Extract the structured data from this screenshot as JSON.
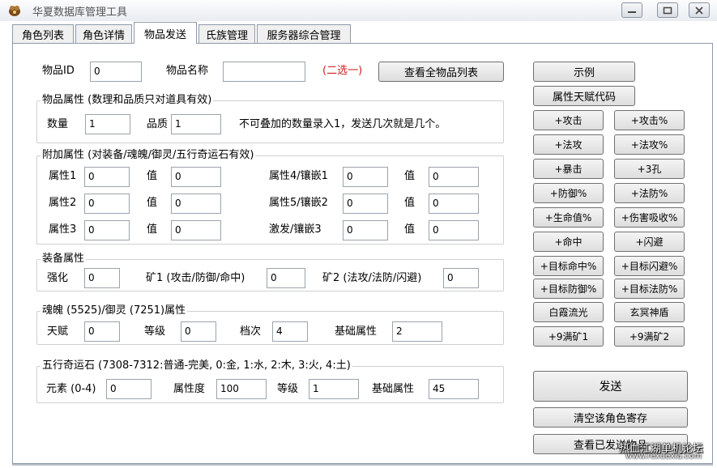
{
  "window": {
    "title": "华夏数据库管理工具",
    "min_icon": "minimize-icon",
    "max_icon": "maximize-icon",
    "close_icon": "close-icon"
  },
  "tabs": [
    {
      "label": "角色列表"
    },
    {
      "label": "角色详情"
    },
    {
      "label": "物品发送",
      "active": true
    },
    {
      "label": "氏族管理"
    },
    {
      "label": "服务器综合管理"
    }
  ],
  "item": {
    "id_label": "物品ID",
    "id_value": "0",
    "name_label": "物品名称",
    "name_value": "",
    "choose_hint": "(二选一)",
    "view_all_button": "查看全物品列表"
  },
  "attr_group": {
    "legend": "物品属性 (数理和品质只对道具有效)",
    "qty_label": "数量",
    "qty_value": "1",
    "quality_label": "品质",
    "quality_value": "1",
    "note": "不可叠加的数量录入1，发送几次就是几个。"
  },
  "extra_group": {
    "legend": "附加属性 (对装备/魂魄/御灵/五行奇运石有效)",
    "value_label": "值",
    "rows": [
      {
        "a_label": "属性1",
        "a_val": "0",
        "a_v": "0",
        "b_label": "属性4/镶嵌1",
        "b_val": "0",
        "b_v": "0"
      },
      {
        "a_label": "属性2",
        "a_val": "0",
        "a_v": "0",
        "b_label": "属性5/镶嵌2",
        "b_val": "0",
        "b_v": "0"
      },
      {
        "a_label": "属性3",
        "a_val": "0",
        "a_v": "0",
        "b_label": "激发/镶嵌3",
        "b_val": "0",
        "b_v": "0"
      }
    ]
  },
  "equip_group": {
    "legend": "装备属性",
    "enhance_label": "强化",
    "enhance_value": "0",
    "mine1_label": "矿1 (攻击/防御/命中)",
    "mine1_value": "0",
    "mine2_label": "矿2 (法攻/法防/闪避)",
    "mine2_value": "0"
  },
  "soul_group": {
    "legend": "魂魄 (5525)/御灵 (7251)属性",
    "talent_label": "天赋",
    "talent_value": "0",
    "level_label": "等级",
    "level_value": "0",
    "grade_label": "档次",
    "grade_value": "4",
    "base_label": "基础属性",
    "base_value": "2"
  },
  "stone_group": {
    "legend": "五行奇运石 (7308-7312:普通-完美, 0:金, 1:水, 2:木, 3:火, 4:土)",
    "element_label": "元素 (0-4)",
    "element_value": "0",
    "degree_label": "属性度",
    "degree_value": "100",
    "level_label": "等级",
    "level_value": "1",
    "base_label": "基础属性",
    "base_value": "45"
  },
  "right": {
    "example": "示例",
    "talent_code": "属性天赋代码",
    "pairs": [
      [
        "+攻击",
        "+攻击%"
      ],
      [
        "+法攻",
        "+法攻%"
      ],
      [
        "+暴击",
        "+3孔"
      ],
      [
        "+防御%",
        "+法防%"
      ],
      [
        "+生命值%",
        "+伤害吸收%"
      ],
      [
        "+命中",
        "+闪避"
      ],
      [
        "+目标命中%",
        "+目标闪避%"
      ],
      [
        "+目标防御%",
        "+目标法防%"
      ],
      [
        "白霞流光",
        "玄冥神盾"
      ],
      [
        "+9满矿1",
        "+9满矿2"
      ]
    ],
    "send": "发送",
    "clear": "清空该角色寄存",
    "view_sent": "查看已发送物品"
  },
  "watermark": {
    "line1": "热血江湖单机论坛",
    "line2": "www.rexuexia.com"
  }
}
